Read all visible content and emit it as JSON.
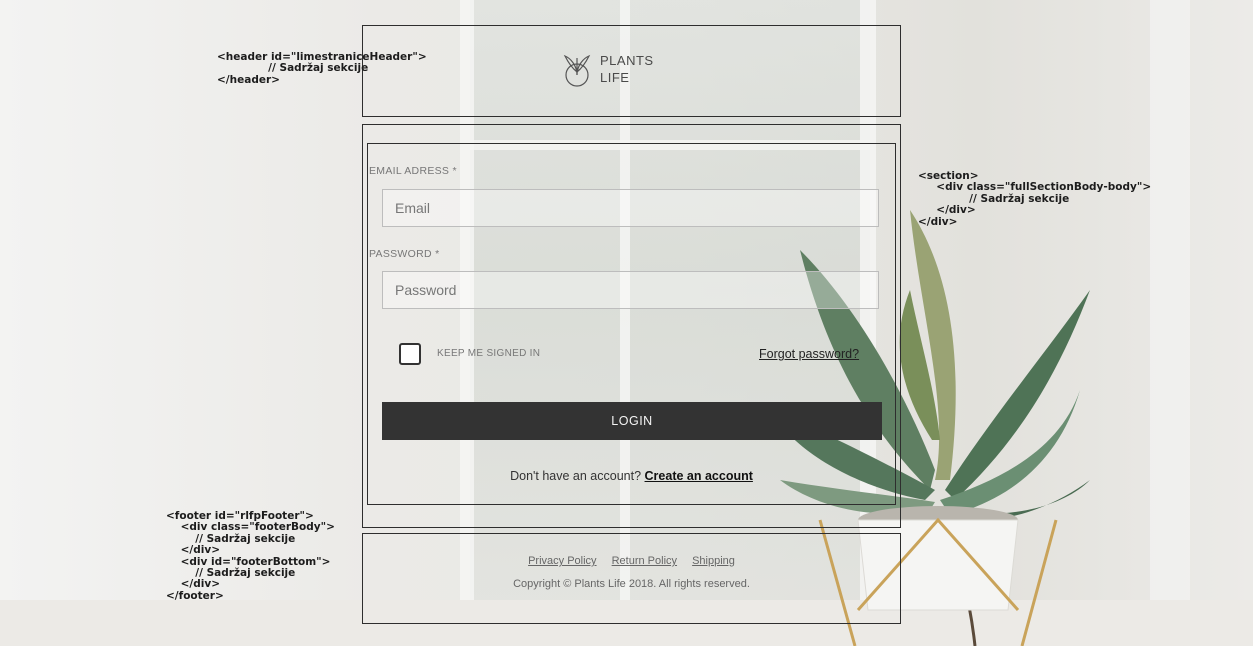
{
  "header": {
    "logo_line1": "PLANTS",
    "logo_line2": "LIFE",
    "logo_icon": "plant-sprout-icon"
  },
  "form": {
    "email_label": "EMAIL ADRESS *",
    "email_placeholder": "Email",
    "password_label": "PASSWORD *",
    "password_placeholder": "Password",
    "remember_label": "KEEP ME SIGNED IN",
    "forgot_link": "Forgot password?",
    "login_button": "LOGIN",
    "signup_prompt": "Don't have an account?",
    "signup_link": "Create an account"
  },
  "footer": {
    "links": [
      "Privacy Policy",
      "Return Policy",
      "Shipping"
    ],
    "copyright": "Copyright © Plants Life 2018. All rights reserved."
  },
  "annotations": {
    "header_code": "<header id=\"limestraniceHeader\">\n              // Sadržaj sekcije\n</header>",
    "section_code": "<section>\n     <div class=\"fullSectionBody-body\">\n              // Sadržaj sekcije\n     </div>\n</div>",
    "footer_code": "<footer id=\"rlfpFooter\">\n    <div class=\"footerBody\">\n        // Sadržaj sekcije\n    </div>\n    <div id=\"footerBottom\">\n        // Sadržaj sekcije\n    </div>\n</footer>"
  },
  "colors": {
    "login_button_bg": "#333333",
    "frame_border": "#2e2e2e",
    "text_dark": "#222222"
  }
}
